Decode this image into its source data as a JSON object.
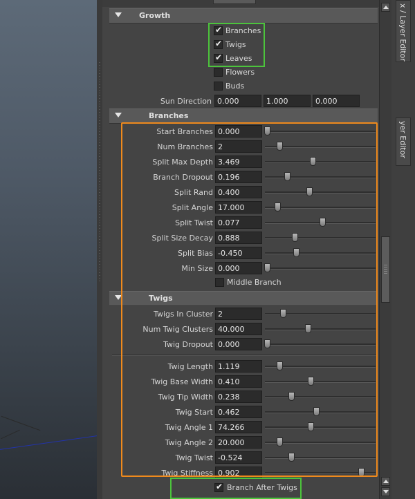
{
  "side_tabs": [
    "x / Layer Editor",
    "yer Editor"
  ],
  "growth": {
    "title": "Growth",
    "checkboxes": [
      {
        "label": "Branches",
        "checked": true
      },
      {
        "label": "Twigs",
        "checked": true
      },
      {
        "label": "Leaves",
        "checked": true
      },
      {
        "label": "Flowers",
        "checked": false
      },
      {
        "label": "Buds",
        "checked": false
      }
    ],
    "sun_direction": {
      "label": "Sun Direction",
      "values": [
        "0.000",
        "1.000",
        "0.000"
      ]
    }
  },
  "branches": {
    "title": "Branches",
    "rows": [
      {
        "label": "Start Branches",
        "value": "0.000",
        "slider": 0.02
      },
      {
        "label": "Num Branches",
        "value": "2",
        "slider": 0.13
      },
      {
        "label": "Split Max Depth",
        "value": "3.469",
        "slider": 0.43
      },
      {
        "label": "Branch Dropout",
        "value": "0.196",
        "slider": 0.2
      },
      {
        "label": "Split Rand",
        "value": "0.400",
        "slider": 0.4
      },
      {
        "label": "Split Angle",
        "value": "17.000",
        "slider": 0.11
      },
      {
        "label": "Split Twist",
        "value": "0.077",
        "slider": 0.52
      },
      {
        "label": "Split Size Decay",
        "value": "0.888",
        "slider": 0.27
      },
      {
        "label": "Split Bias",
        "value": "-0.450",
        "slider": 0.28
      },
      {
        "label": "Min Size",
        "value": "0.000",
        "slider": 0.02
      }
    ],
    "middle_branch": {
      "label": "Middle Branch",
      "checked": false
    }
  },
  "twigs": {
    "title": "Twigs",
    "rows_a": [
      {
        "label": "Twigs In Cluster",
        "value": "2",
        "slider": 0.16
      },
      {
        "label": "Num Twig Clusters",
        "value": "40.000",
        "slider": 0.39
      },
      {
        "label": "Twig Dropout",
        "value": "0.000",
        "slider": 0.02
      }
    ],
    "rows_b": [
      {
        "label": "Twig Length",
        "value": "1.119",
        "slider": 0.13
      },
      {
        "label": "Twig Base Width",
        "value": "0.410",
        "slider": 0.41
      },
      {
        "label": "Twig Tip Width",
        "value": "0.238",
        "slider": 0.24
      },
      {
        "label": "Twig Start",
        "value": "0.462",
        "slider": 0.46
      },
      {
        "label": "Twig Angle 1",
        "value": "74.266",
        "slider": 0.41
      },
      {
        "label": "Twig Angle 2",
        "value": "20.000",
        "slider": 0.13
      },
      {
        "label": "Twig Twist",
        "value": "-0.524",
        "slider": 0.24
      },
      {
        "label": "Twig Stiffness",
        "value": "0.902",
        "slider": 0.87
      }
    ]
  },
  "branch_after_twigs": {
    "label": "Branch After Twigs",
    "checked": true
  },
  "colors": {
    "highlight_green": "#4cc43c",
    "highlight_orange": "#f08a1c"
  }
}
